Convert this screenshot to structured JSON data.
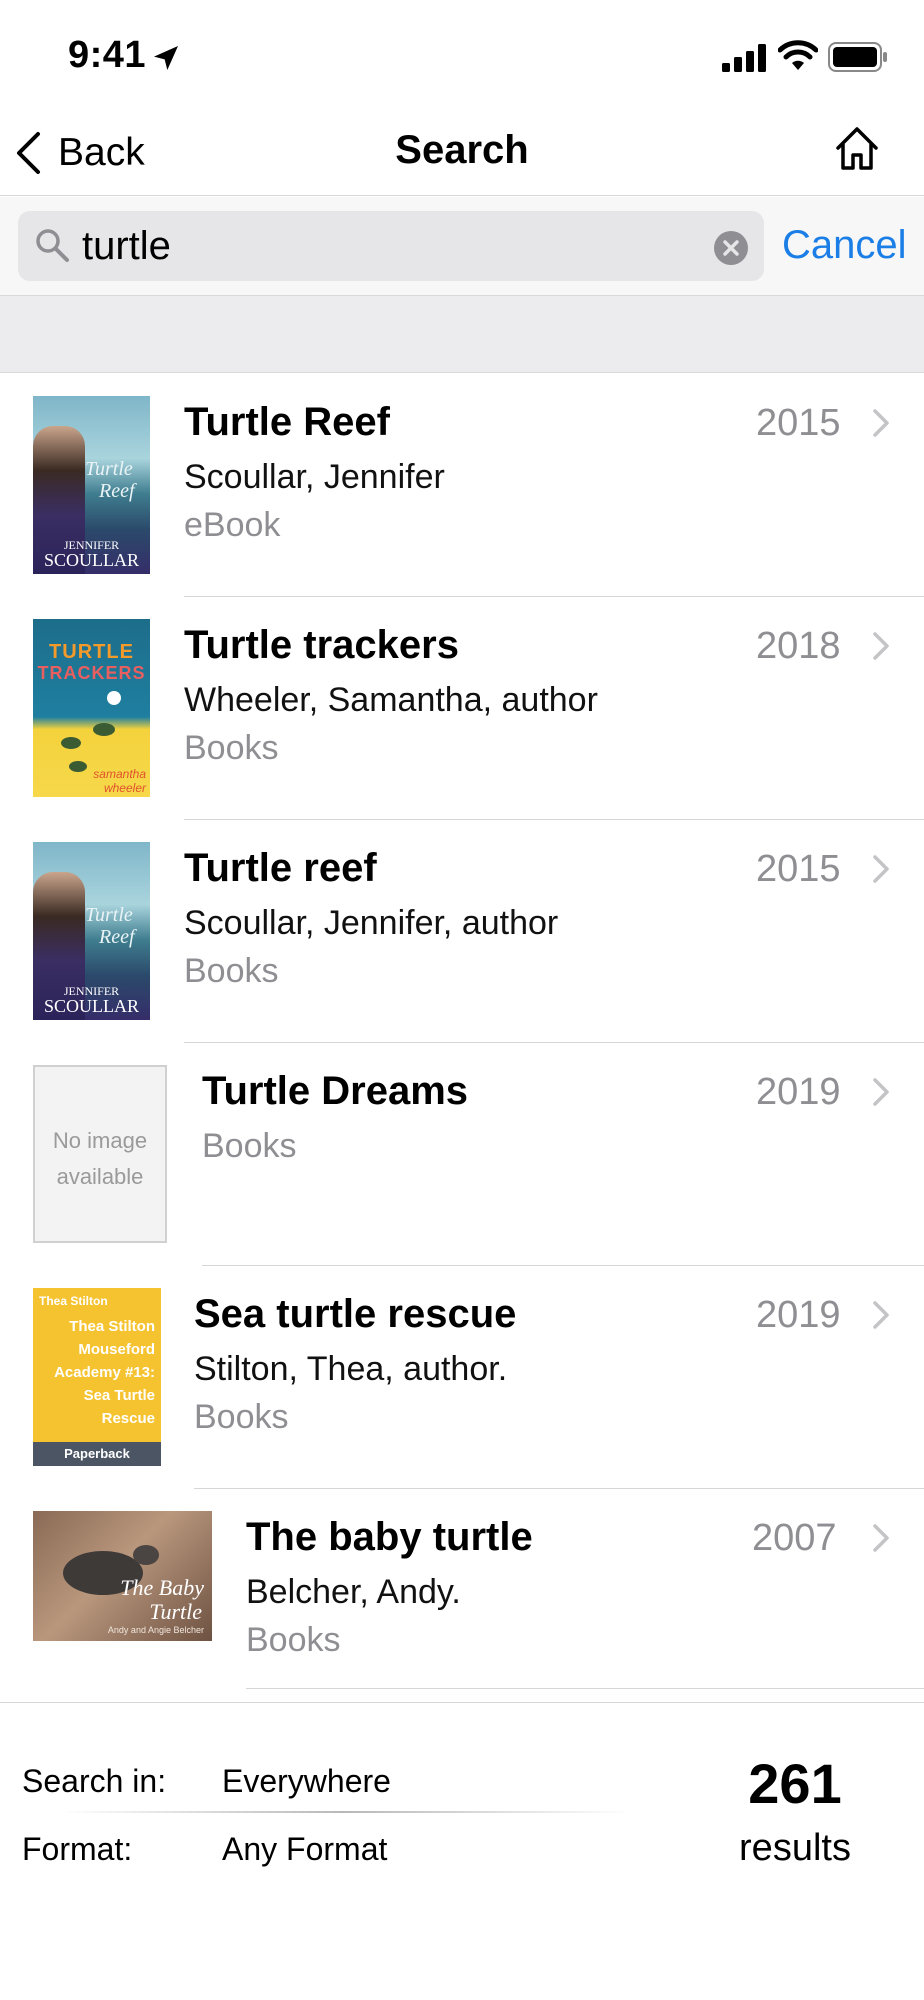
{
  "status_bar": {
    "time": "9:41"
  },
  "nav": {
    "back_label": "Back",
    "title": "Search"
  },
  "search": {
    "query": "turtle",
    "cancel_label": "Cancel"
  },
  "results": [
    {
      "title": "Turtle Reef",
      "author": "Scoullar, Jennifer",
      "format": "eBook",
      "year": "2015",
      "cover": {
        "kind": "image",
        "lines": [
          "Turtle",
          "Reef",
          "JENNIFER",
          "SCOULLAR"
        ]
      }
    },
    {
      "title": "Turtle trackers",
      "author": "Wheeler, Samantha, author",
      "format": "Books",
      "year": "2018",
      "cover": {
        "kind": "image",
        "lines": [
          "TURTLE",
          "TRACKERS",
          "samantha",
          "wheeler"
        ]
      }
    },
    {
      "title": "Turtle reef",
      "author": "Scoullar, Jennifer, author",
      "format": "Books",
      "year": "2015",
      "cover": {
        "kind": "image",
        "lines": [
          "Turtle",
          "Reef",
          "JENNIFER",
          "SCOULLAR"
        ]
      }
    },
    {
      "title": "Turtle Dreams",
      "author": "",
      "format": "Books",
      "year": "2019",
      "cover": {
        "kind": "none",
        "lines": [
          "No image",
          "available"
        ]
      }
    },
    {
      "title": "Sea turtle rescue",
      "author": "Stilton, Thea, author.",
      "format": "Books",
      "year": "2019",
      "cover": {
        "kind": "image",
        "lines": [
          "Thea Stilton",
          "Thea Stilton",
          "Mouseford",
          "Academy #13:",
          "Sea Turtle",
          "Rescue",
          "Paperback"
        ]
      }
    },
    {
      "title": "The baby turtle",
      "author": "Belcher, Andy.",
      "format": "Books",
      "year": "2007",
      "cover": {
        "kind": "image",
        "lines": [
          "The Baby",
          "Turtle",
          "Andy and Angie Belcher"
        ]
      }
    }
  ],
  "footer": {
    "search_in_label": "Search in:",
    "search_in_value": "Everywhere",
    "format_label": "Format:",
    "format_value": "Any Format",
    "count": "261",
    "count_label": "results"
  },
  "colors": {
    "accent": "#1a7ee6",
    "secondary_text": "#8e8e93",
    "band": "#ececef"
  },
  "icons": [
    "location-arrow-icon",
    "signal-icon",
    "wifi-icon",
    "battery-icon",
    "chevron-left-icon",
    "home-icon",
    "search-icon",
    "clear-icon",
    "chevron-right-icon"
  ]
}
